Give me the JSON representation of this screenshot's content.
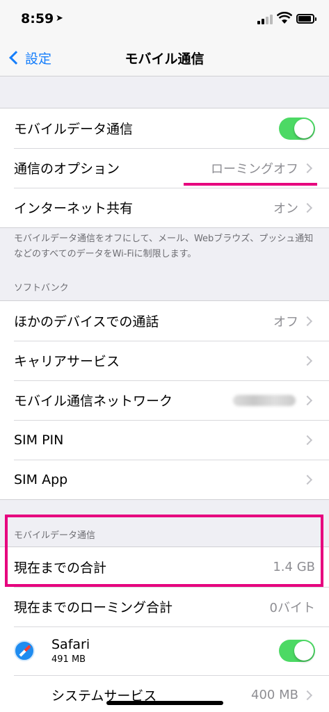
{
  "status": {
    "time": "8:59"
  },
  "nav": {
    "back_label": "設定",
    "title": "モバイル通信"
  },
  "group1": {
    "mobile_data_label": "モバイルデータ通信",
    "mobile_data_on": true,
    "options_label": "通信のオプション",
    "options_value": "ローミングオフ",
    "hotspot_label": "インターネット共有",
    "hotspot_value": "オン"
  },
  "group1_footer": "モバイルデータ通信をオフにして、メール、Webブラウズ、プッシュ通知などのすべてのデータをWi-Fiに制限します。",
  "carrier_header": "ソフトバンク",
  "carrier": {
    "other_devices_label": "ほかのデバイスでの通話",
    "other_devices_value": "オフ",
    "carrier_services_label": "キャリアサービス",
    "network_label": "モバイル通信ネットワーク",
    "sim_pin_label": "SIM PIN",
    "sim_app_label": "SIM App"
  },
  "usage_header": "モバイルデータ通信",
  "usage": {
    "total_label": "現在までの合計",
    "total_value": "1.4 GB",
    "roaming_label": "現在までのローミング合計",
    "roaming_value": "0バイト",
    "safari_name": "Safari",
    "safari_size": "491 MB",
    "safari_on": true,
    "system_label": "システムサービス",
    "system_value": "400 MB"
  },
  "colors": {
    "accent": "#157efb",
    "toggle_on": "#4cd964",
    "highlight": "#e6007e"
  }
}
